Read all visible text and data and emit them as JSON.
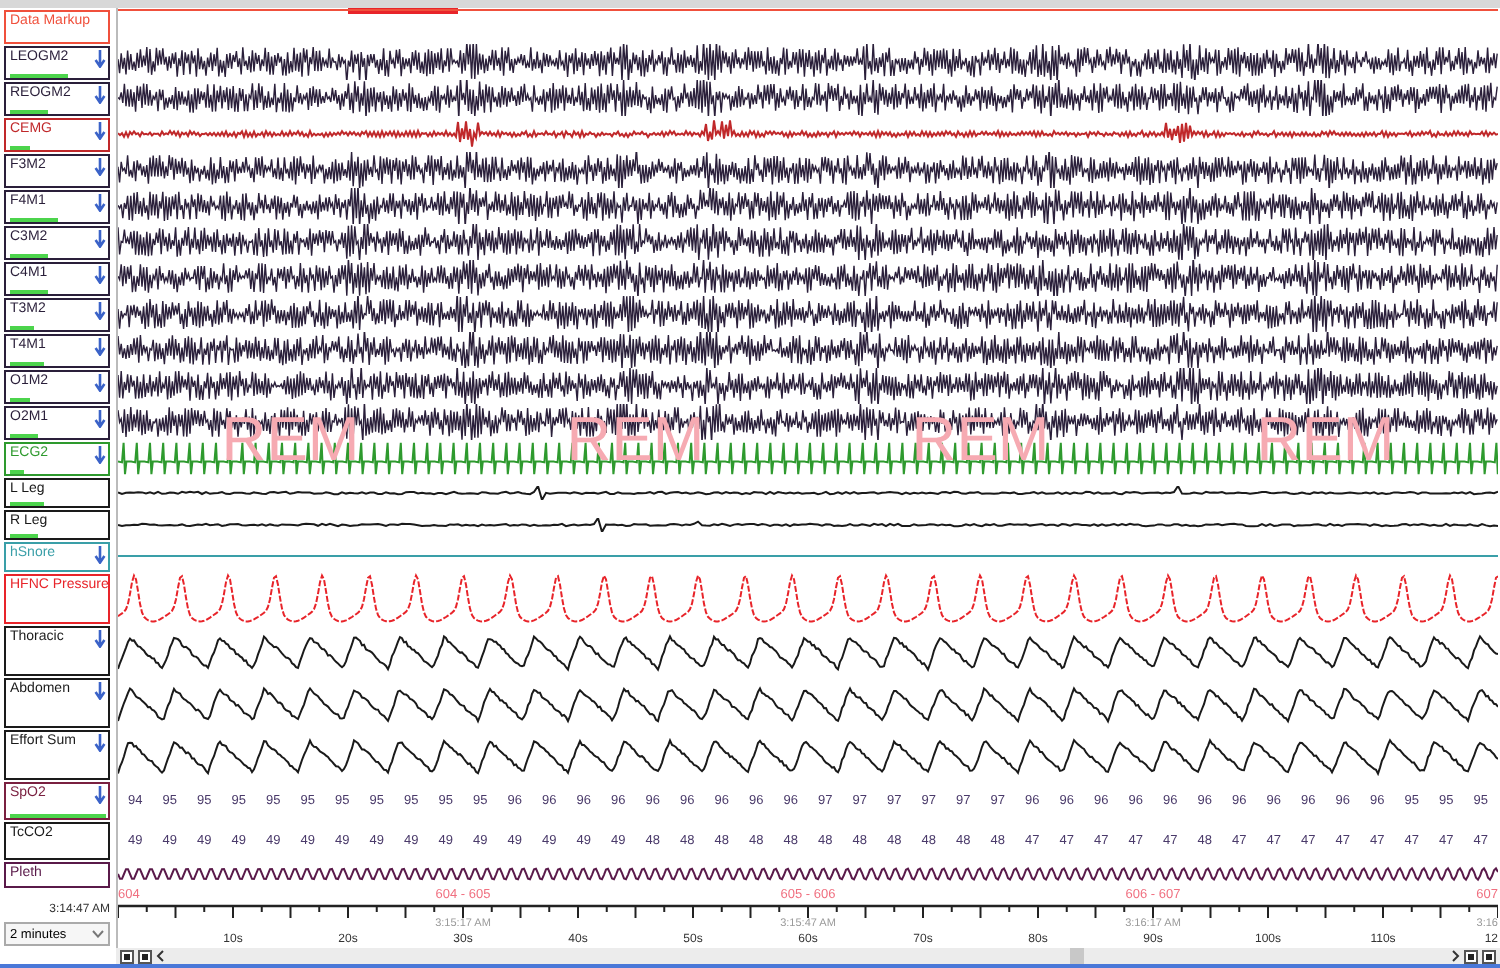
{
  "channels": [
    {
      "name": "Data Markup",
      "kind": "markup",
      "color": "#f0503c",
      "scale_arrow": false
    },
    {
      "name": "LEOGM2",
      "kind": "eeg",
      "color": "#2a1f3a",
      "scale_arrow": true,
      "level": 0.6
    },
    {
      "name": "REOGM2",
      "kind": "eeg",
      "color": "#2a1f3a",
      "scale_arrow": true,
      "level": 0.4
    },
    {
      "name": "CEMG",
      "kind": "emg",
      "color": "#c0282a",
      "scale_arrow": true,
      "level": 0.2
    },
    {
      "name": "F3M2",
      "kind": "eeg",
      "color": "#2a1f3a",
      "scale_arrow": true
    },
    {
      "name": "F4M1",
      "kind": "eeg",
      "color": "#2a1f3a",
      "scale_arrow": true,
      "level": 0.5
    },
    {
      "name": "C3M2",
      "kind": "eeg",
      "color": "#2a1f3a",
      "scale_arrow": true,
      "level": 0.4
    },
    {
      "name": "C4M1",
      "kind": "eeg",
      "color": "#2a1f3a",
      "scale_arrow": true,
      "level": 0.4
    },
    {
      "name": "T3M2",
      "kind": "eeg",
      "color": "#2a1f3a",
      "scale_arrow": true,
      "level": 0.25
    },
    {
      "name": "T4M1",
      "kind": "eeg",
      "color": "#2a1f3a",
      "scale_arrow": true,
      "level": 0.35
    },
    {
      "name": "O1M2",
      "kind": "eeg",
      "color": "#2a1f3a",
      "scale_arrow": true,
      "level": 0.2
    },
    {
      "name": "O2M1",
      "kind": "eeg",
      "color": "#2a1f3a",
      "scale_arrow": true,
      "level": 0.3
    },
    {
      "name": "ECG2",
      "kind": "ecg",
      "color": "#2e9a2e",
      "scale_arrow": true,
      "level": 0.15
    },
    {
      "name": "L Leg",
      "kind": "leg",
      "color": "#1a1a1a",
      "scale_arrow": false,
      "level": 0.35
    },
    {
      "name": "R Leg",
      "kind": "leg",
      "color": "#1a1a1a",
      "scale_arrow": false,
      "level": 0.3
    },
    {
      "name": "hSnore",
      "kind": "snore",
      "color": "#3a9fa8",
      "scale_arrow": true
    },
    {
      "name": "HFNC Pressure",
      "kind": "flow",
      "color": "#e8242a",
      "scale_arrow": false
    },
    {
      "name": "Thoracic",
      "kind": "effort",
      "color": "#1a1a1a",
      "scale_arrow": true
    },
    {
      "name": "Abdomen",
      "kind": "effort",
      "color": "#1a1a1a",
      "scale_arrow": true
    },
    {
      "name": "Effort Sum",
      "kind": "effort",
      "color": "#1a1a1a",
      "scale_arrow": true
    },
    {
      "name": "SpO2",
      "kind": "numeric",
      "color": "#7a2040",
      "scale_arrow": true,
      "level": 1,
      "values": [
        "94",
        "95",
        "95",
        "95",
        "95",
        "95",
        "95",
        "95",
        "95",
        "95",
        "95",
        "96",
        "96",
        "96",
        "96",
        "96",
        "96",
        "96",
        "96",
        "96",
        "97",
        "97",
        "97",
        "97",
        "97",
        "97",
        "96",
        "96",
        "96",
        "96",
        "96",
        "96",
        "96",
        "96",
        "96",
        "96",
        "96",
        "95",
        "95",
        "95"
      ]
    },
    {
      "name": "TcCO2",
      "kind": "numeric",
      "color": "#1a1a1a",
      "scale_arrow": false,
      "values": [
        "49",
        "49",
        "49",
        "49",
        "49",
        "49",
        "49",
        "49",
        "49",
        "49",
        "49",
        "49",
        "49",
        "49",
        "49",
        "48",
        "48",
        "48",
        "48",
        "48",
        "48",
        "48",
        "48",
        "48",
        "48",
        "48",
        "47",
        "47",
        "47",
        "47",
        "47",
        "48",
        "47",
        "47",
        "47",
        "47",
        "47",
        "47",
        "47",
        "47"
      ]
    },
    {
      "name": "Pleth",
      "kind": "pleth",
      "color": "#5a1a4a",
      "scale_arrow": false
    }
  ],
  "sleep_stages": [
    "REM",
    "REM",
    "REM",
    "REM"
  ],
  "epoch_labels": [
    "604",
    "604 - 605",
    "605 - 606",
    "606 - 607",
    "607"
  ],
  "clock_labels": [
    "3:15:17 AM",
    "3:15:47 AM",
    "3:16:17 AM",
    "3:16"
  ],
  "second_labels": [
    "10s",
    "20s",
    "30s",
    "40s",
    "50s",
    "60s",
    "70s",
    "80s",
    "90s",
    "100s",
    "110s",
    "12"
  ],
  "start_time": "3:14:47 AM",
  "page_length": "2 minutes"
}
